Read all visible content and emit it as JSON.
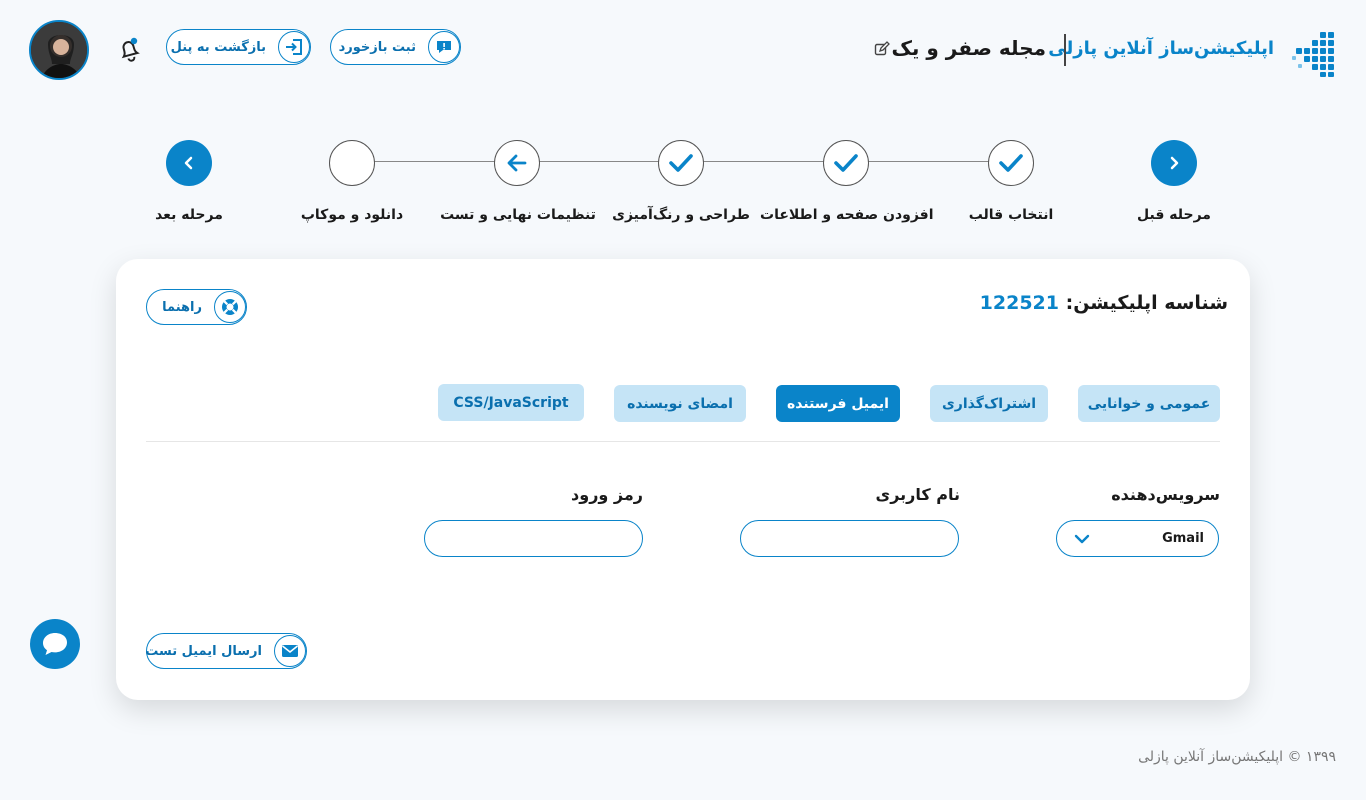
{
  "header": {
    "brand_name": "اپلیکیشن‌ساز آنلاین پازلی",
    "project_title": "مجله صفر و یک",
    "feedback_label": "ثبت بازخورد",
    "back_label": "بازگشت به پنل"
  },
  "stepper": {
    "prev_label": "مرحله قبل",
    "next_label": "مرحله بعد",
    "steps": [
      {
        "label": "انتخاب قالب",
        "state": "done"
      },
      {
        "label": "افزودن صفحه و اطلاعات",
        "state": "done"
      },
      {
        "label": "طراحی و رنگ‌آمیزی",
        "state": "done"
      },
      {
        "label": "تنظیمات نهایی و تست",
        "state": "current"
      },
      {
        "label": "دانلود و موکاپ",
        "state": "pending"
      }
    ]
  },
  "card": {
    "app_id_label": "شناسه اپلیکیشن:",
    "app_id_value": "122521",
    "help_label": "راهنما",
    "tabs": [
      {
        "label": "عمومی و خوانایی",
        "active": false
      },
      {
        "label": "اشتراک‌گذاری",
        "active": false
      },
      {
        "label": "ایمیل فرستنده",
        "active": true
      },
      {
        "label": "امضای نویسنده",
        "active": false
      },
      {
        "label": "CSS/JavaScript",
        "active": false
      }
    ],
    "fields": {
      "provider_label": "سرویس‌دهنده",
      "provider_value": "Gmail",
      "username_label": "نام کاربری",
      "username_value": "",
      "password_label": "رمز ورود",
      "password_value": ""
    },
    "send_test_label": "ارسال ایمیل تست"
  },
  "footer": {
    "text": "۱۳۹۹ © اپلیکیشن‌ساز آنلاین پازلی"
  },
  "colors": {
    "accent": "#0a84c9",
    "tab_inactive": "#c5e4f6",
    "background": "#f6f9fc"
  },
  "icons": [
    "puzzle-logo-icon",
    "edit-icon",
    "feedback-icon",
    "exit-icon",
    "bell-icon",
    "check-icon",
    "arrow-left-icon",
    "chevron-right-icon",
    "chevron-left-icon",
    "lifebuoy-icon",
    "chevron-down-icon",
    "mail-icon",
    "chat-icon"
  ]
}
